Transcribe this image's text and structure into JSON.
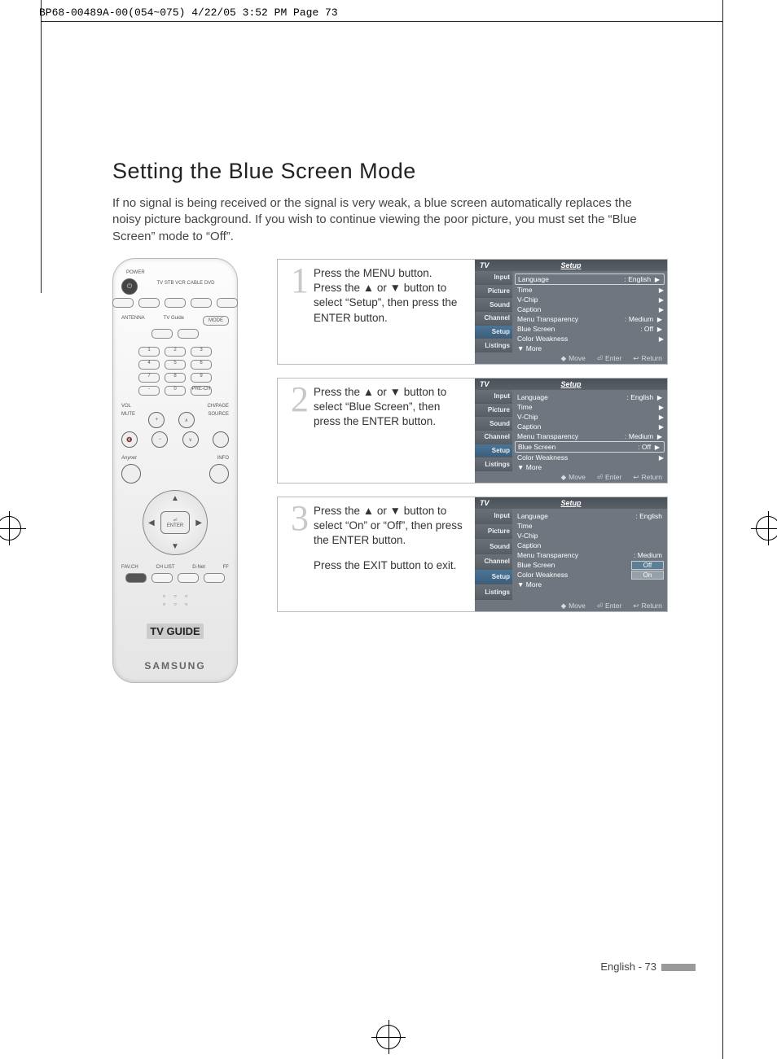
{
  "header_tag": "BP68-00489A-00(054~075)  4/22/05  3:52 PM  Page 73",
  "title": "Setting the Blue Screen Mode",
  "intro": "If no signal is being received or the signal is very weak, a blue screen automatically replaces the noisy picture background. If you wish to continue viewing the poor picture, you must set the “Blue Screen” mode to “Off”.",
  "remote": {
    "power": "POWER",
    "modes": "TV  STB  VCR  CABLE  DVD",
    "antenna": "ANTENNA",
    "tvguide": "TV Guide",
    "mode": "MODE",
    "precH": "PRE-CH",
    "vol": "VOL",
    "chpage": "CH/PAGE",
    "mute": "MUTE",
    "source": "SOURCE",
    "anynet": "Anynet",
    "info": "INFO",
    "enter": "ENTER",
    "favch": "FAV.CH",
    "chlist": "CH LIST",
    "dnet": "D-Net",
    "ff": "FF",
    "guide_logo": "TV GUIDE",
    "brand": "SAMSUNG"
  },
  "sidebar": [
    "Input",
    "Picture",
    "Sound",
    "Channel",
    "Setup",
    "Listings"
  ],
  "sidebar_prefix": "TV GUIDE",
  "osd": {
    "tv": "TV",
    "title": "Setup"
  },
  "nav": {
    "move": "Move",
    "enter": "Enter",
    "return": "Return"
  },
  "menu": {
    "language": "Language",
    "language_v": ": English",
    "time": "Time",
    "vchip": "V-Chip",
    "caption": "Caption",
    "transp": "Menu Transparency",
    "transp_v": ": Medium",
    "blue": "Blue Screen",
    "blue_v": ": Off",
    "cw": "Color Weakness",
    "more": "▼ More",
    "off": "Off",
    "on": "On"
  },
  "steps": {
    "s1n": "1",
    "s1": "Press the MENU button.\nPress the ▲ or ▼ button to select “Setup”, then press the ENTER button.",
    "s2n": "2",
    "s2": "Press the ▲ or ▼ button to select “Blue Screen”, then press the ENTER button.",
    "s3n": "3",
    "s3a": "Press the ▲ or ▼ button to select “On” or “Off”, then press the ENTER button.",
    "s3b": "Press the EXIT button to exit."
  },
  "footer": "English - 73"
}
